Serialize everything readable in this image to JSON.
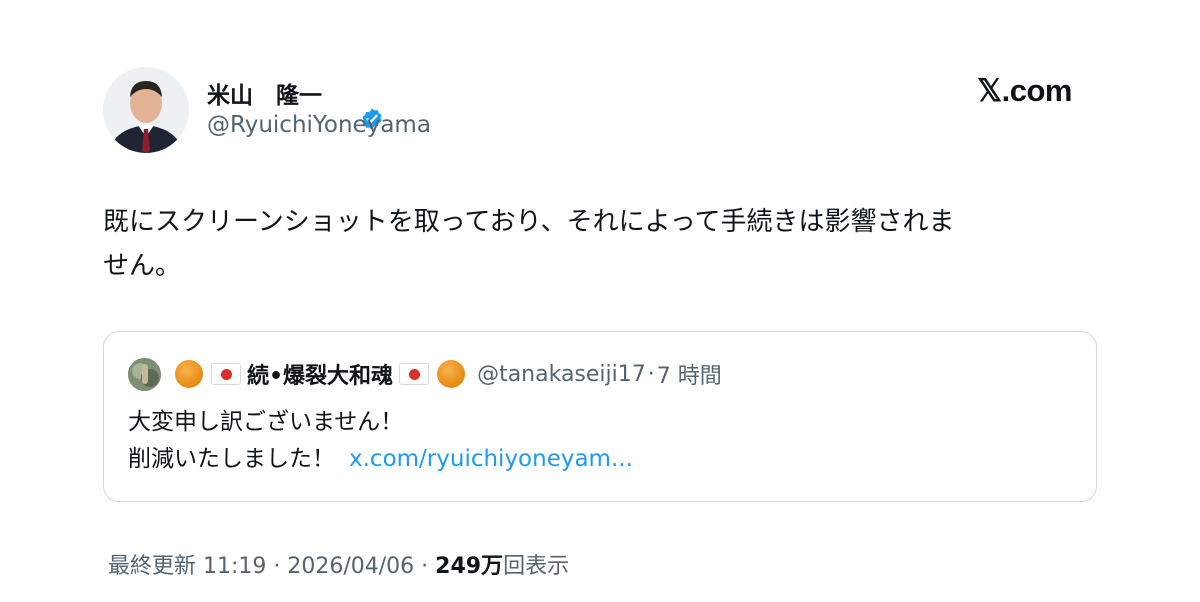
{
  "author": {
    "name": "米山　隆一",
    "handle": "@RyuichiYoneyama",
    "verified": true
  },
  "site_mark": "𝕏.com",
  "tweet": {
    "line1": "既にスクリーンショットを取っており、それによって手続きは影響されま",
    "line2": "せん。"
  },
  "quoted_tweet": {
    "display_name": "続•爆裂大和魂",
    "handle": "@tanakaseiji17",
    "separator": "·",
    "time": "7 時間",
    "line1": "大変申し訳ございません！",
    "line2": "削減いたしました！",
    "link": "x.com/ryuichiyoneyam..."
  },
  "meta": {
    "updated_label": "最終更新 11:19 · 2026/04/06",
    "dot": " · ",
    "views_count": "249万",
    "views_label": "回表示"
  },
  "icons": [
    "verified-badge-icon",
    "orange-circle-emoji",
    "japan-flag-emoji"
  ],
  "colors": {
    "verified": "#1d9bf0",
    "link": "#1d9bf0",
    "muted": "#536471",
    "border": "#cfd9de"
  }
}
